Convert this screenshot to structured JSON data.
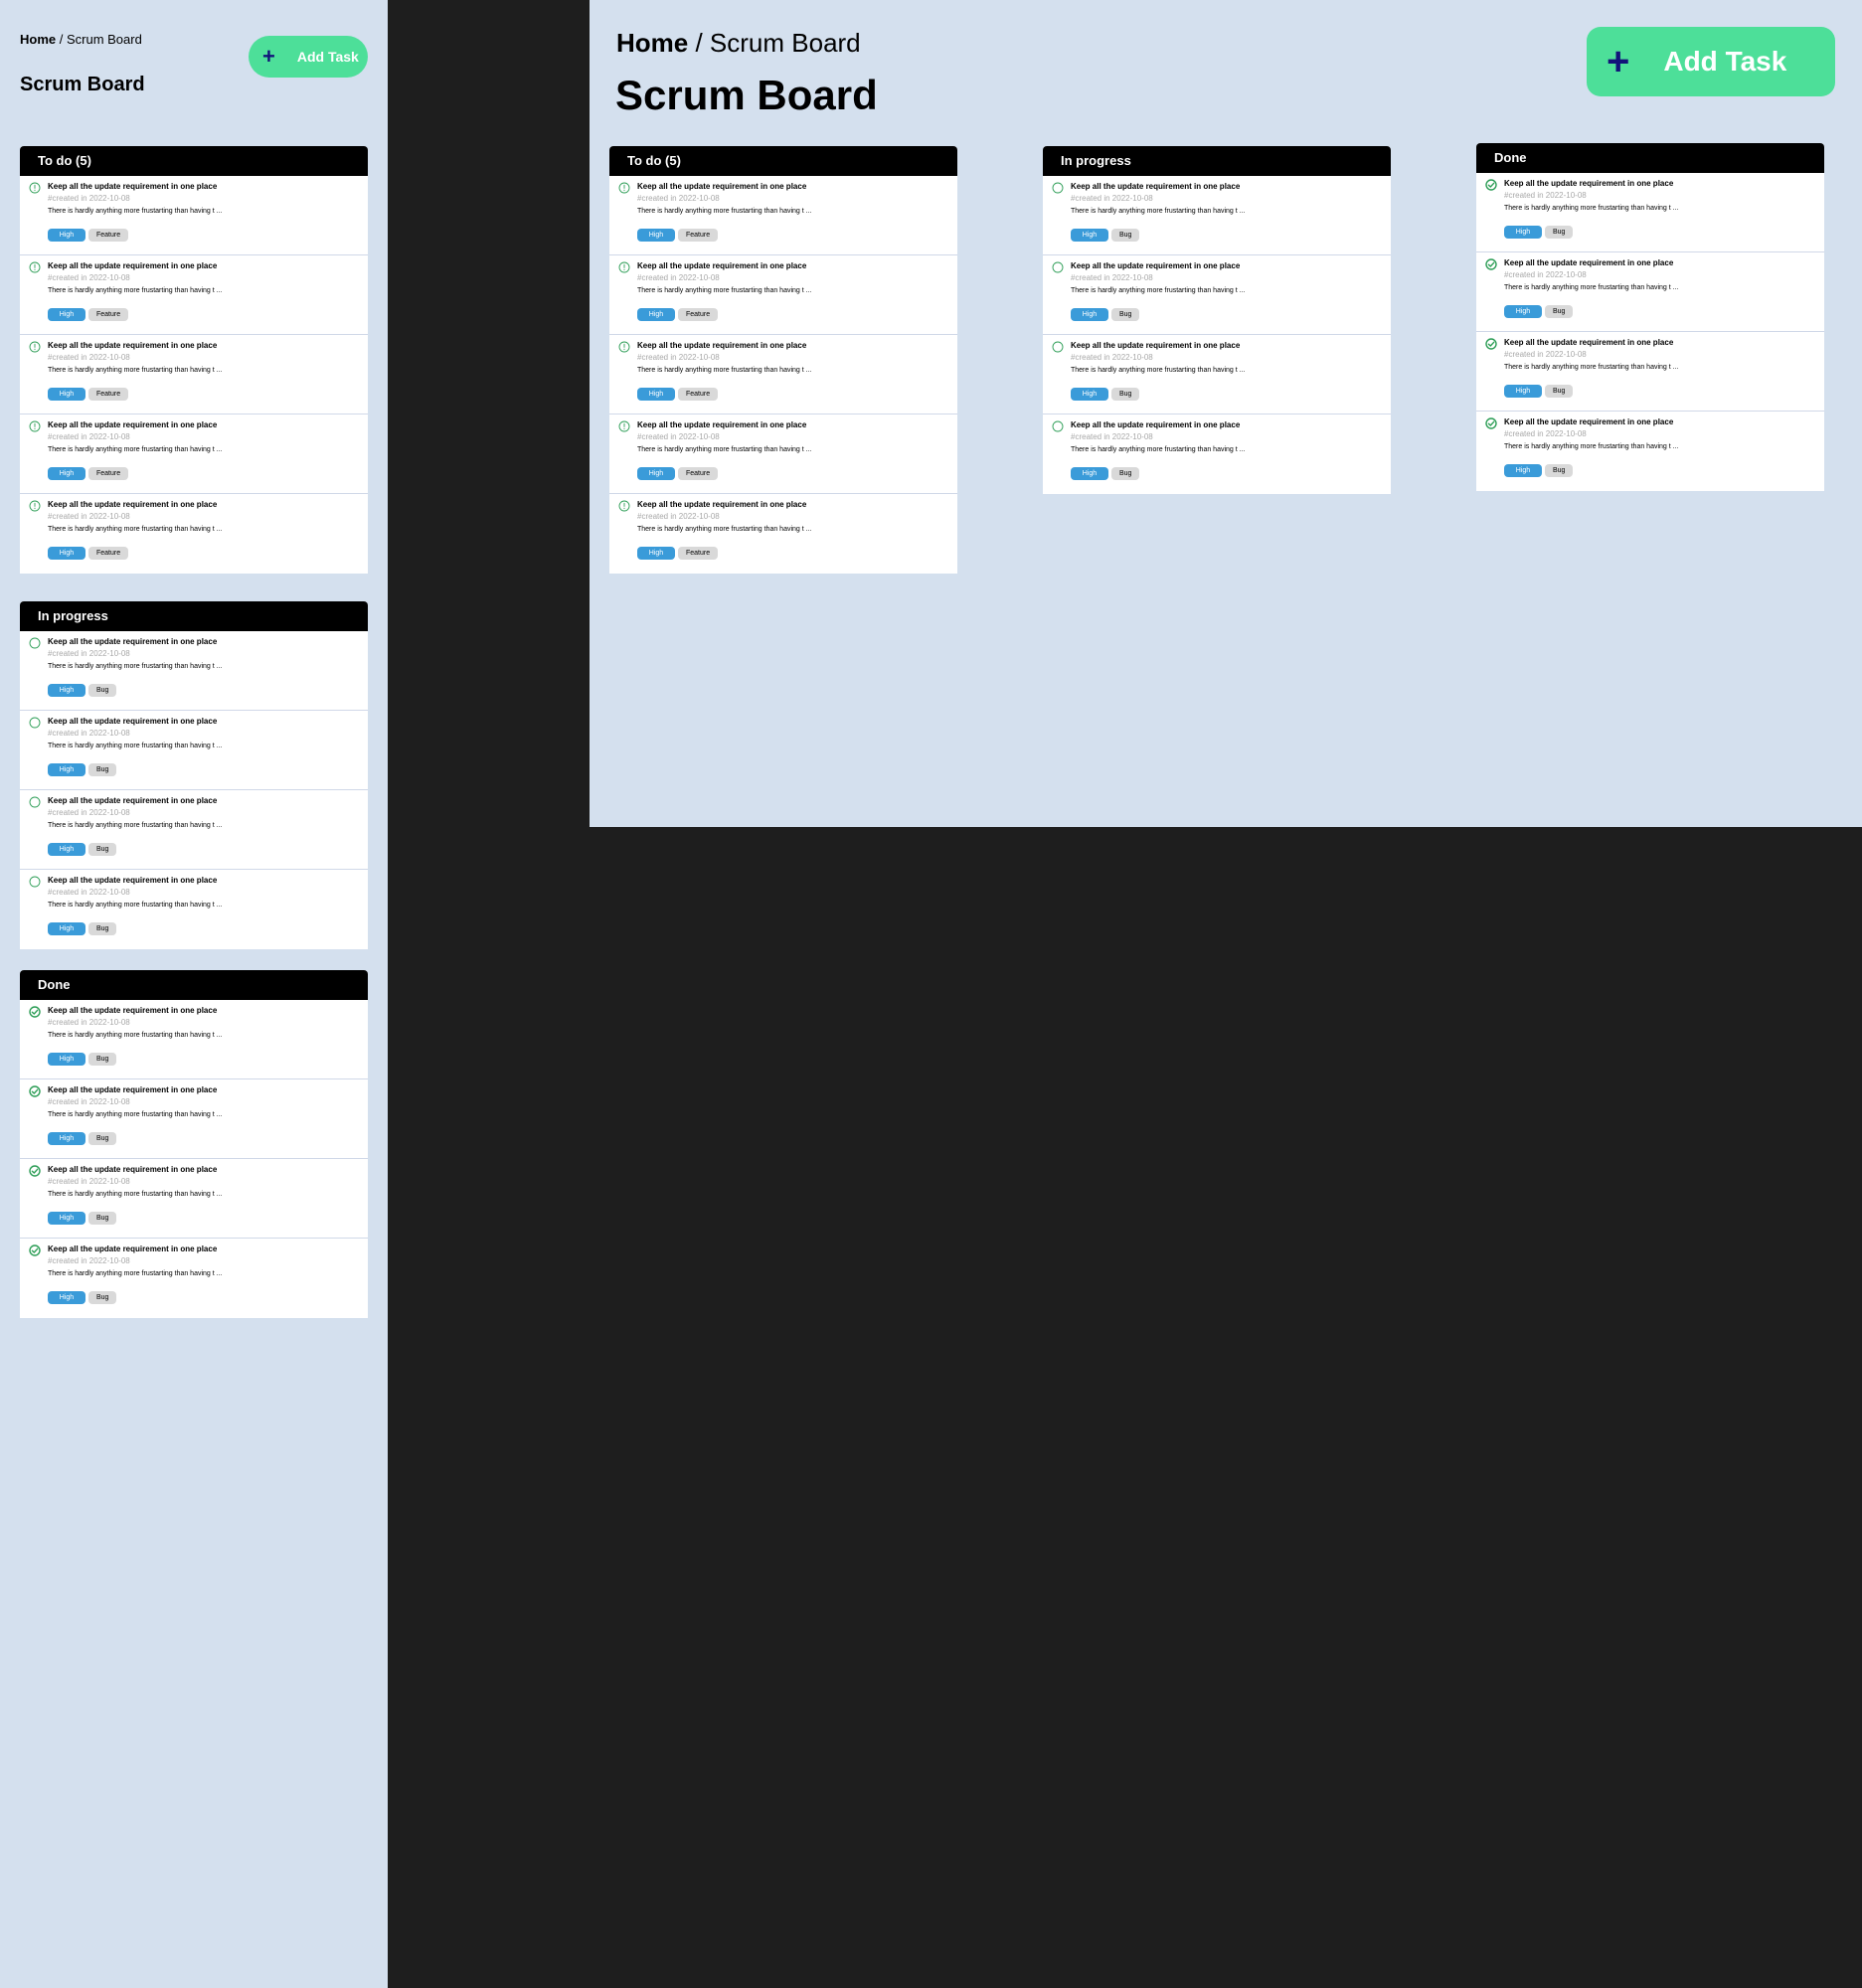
{
  "breadcrumb": {
    "home": "Home",
    "separator": " / ",
    "current": "Scrum Board"
  },
  "page_title": "Scrum Board",
  "add_button": {
    "icon": "plus-icon",
    "label": "Add Task"
  },
  "colors": {
    "frame_bg": "#d4e0ee",
    "canvas_bg": "#1e1e1e",
    "add_button": "#4ddf99",
    "plus_icon": "#12127a",
    "column_header": "#000000",
    "priority_tag": "#3a9bd9",
    "type_tag": "#d9d9d9",
    "status_green": "#2e9e57"
  },
  "columns": [
    {
      "id": "todo",
      "title": "To do (5)",
      "status_icon": "pending-icon",
      "tasks": [
        {
          "title": "Keep all the update requirement in one place",
          "meta": "#created in 2022-10-08",
          "description": "There is hardly anything more frustarting than having t ...",
          "priority": "High",
          "type": "Feature"
        },
        {
          "title": "Keep all the update requirement in one place",
          "meta": "#created in 2022-10-08",
          "description": "There is hardly anything more frustarting than having t ...",
          "priority": "High",
          "type": "Feature"
        },
        {
          "title": "Keep all the update requirement in one place",
          "meta": "#created in 2022-10-08",
          "description": "There is hardly anything more frustarting than having t ...",
          "priority": "High",
          "type": "Feature"
        },
        {
          "title": "Keep all the update requirement in one place",
          "meta": "#created in 2022-10-08",
          "description": "There is hardly anything more frustarting than having t ...",
          "priority": "High",
          "type": "Feature"
        },
        {
          "title": "Keep all the update requirement in one place",
          "meta": "#created in 2022-10-08",
          "description": "There is hardly anything more frustarting than having t ...",
          "priority": "High",
          "type": "Feature"
        }
      ]
    },
    {
      "id": "inprogress",
      "title": "In progress",
      "status_icon": "open-circle-icon",
      "tasks": [
        {
          "title": "Keep all the update requirement in one place",
          "meta": "#created in 2022-10-08",
          "description": "There is hardly anything more frustarting than having t ...",
          "priority": "High",
          "type": "Bug"
        },
        {
          "title": "Keep all the update requirement in one place",
          "meta": "#created in 2022-10-08",
          "description": "There is hardly anything more frustarting than having t ...",
          "priority": "High",
          "type": "Bug"
        },
        {
          "title": "Keep all the update requirement in one place",
          "meta": "#created in 2022-10-08",
          "description": "There is hardly anything more frustarting than having t ...",
          "priority": "High",
          "type": "Bug"
        },
        {
          "title": "Keep all the update requirement in one place",
          "meta": "#created in 2022-10-08",
          "description": "There is hardly anything more frustarting than having t ...",
          "priority": "High",
          "type": "Bug"
        }
      ]
    },
    {
      "id": "done",
      "title": "Done",
      "status_icon": "check-circle-icon",
      "tasks": [
        {
          "title": "Keep all the update requirement in one place",
          "meta": "#created in 2022-10-08",
          "description": "There is hardly anything more frustarting than having t ...",
          "priority": "High",
          "type": "Bug"
        },
        {
          "title": "Keep all the update requirement in one place",
          "meta": "#created in 2022-10-08",
          "description": "There is hardly anything more frustarting than having t ...",
          "priority": "High",
          "type": "Bug"
        },
        {
          "title": "Keep all the update requirement in one place",
          "meta": "#created in 2022-10-08",
          "description": "There is hardly anything more frustarting than having t ...",
          "priority": "High",
          "type": "Bug"
        },
        {
          "title": "Keep all the update requirement in one place",
          "meta": "#created in 2022-10-08",
          "description": "There is hardly anything more frustarting than having t ...",
          "priority": "High",
          "type": "Bug"
        }
      ]
    }
  ]
}
